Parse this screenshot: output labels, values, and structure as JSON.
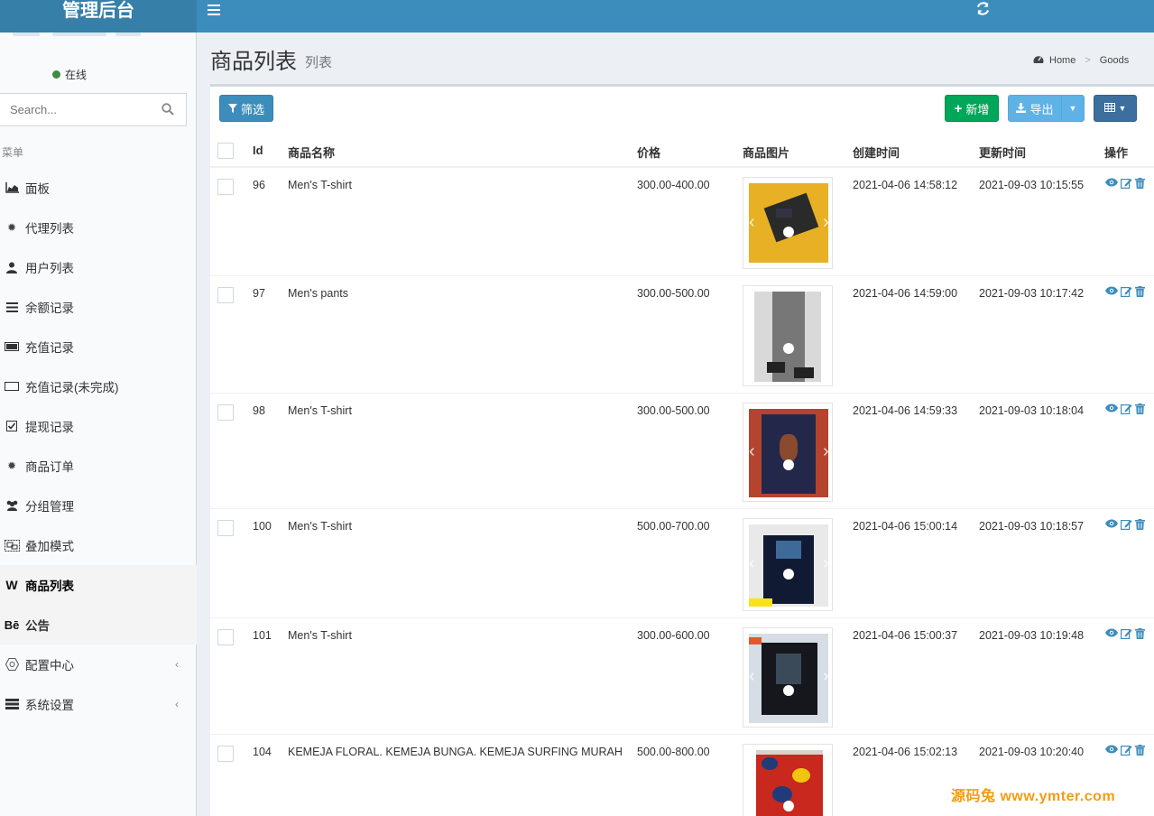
{
  "header": {
    "brand": "管理后台"
  },
  "sidebar": {
    "status_text": "在线",
    "search_placeholder": "Search...",
    "menu_header": "菜单",
    "items": [
      {
        "label": "面板",
        "icon": "area-chart-icon"
      },
      {
        "label": "代理列表",
        "icon": "gear-icon"
      },
      {
        "label": "用户列表",
        "icon": "user-icon"
      },
      {
        "label": "余额记录",
        "icon": "list-icon"
      },
      {
        "label": "充值记录",
        "icon": "battery-icon"
      },
      {
        "label": "充值记录(未完成)",
        "icon": "battery-empty-icon"
      },
      {
        "label": "提现记录",
        "icon": "check-square-icon"
      },
      {
        "label": "商品订单",
        "icon": "gear-icon"
      },
      {
        "label": "分组管理",
        "icon": "users-icon"
      },
      {
        "label": "叠加模式",
        "icon": "object-group-icon"
      },
      {
        "label": "商品列表",
        "icon": "wikipedia-icon"
      },
      {
        "label": "公告",
        "icon": "behance-icon"
      },
      {
        "label": "配置中心",
        "icon": "cog-icon"
      },
      {
        "label": "系统设置",
        "icon": "server-icon"
      }
    ]
  },
  "page": {
    "title": "商品列表",
    "subtitle": "列表",
    "breadcrumb": [
      "Home",
      "Goods"
    ]
  },
  "toolbar": {
    "filter_label": "筛选",
    "add_label": "新增",
    "export_label": "导出"
  },
  "table": {
    "columns": [
      "Id",
      "商品名称",
      "价格",
      "商品图片",
      "创建时间",
      "更新时间",
      "操作"
    ],
    "rows": [
      {
        "id": "96",
        "name": "Men's T-shirt",
        "price": "300.00-400.00",
        "created": "2021-04-06 14:58:12",
        "updated": "2021-09-03 10:15:55"
      },
      {
        "id": "97",
        "name": "Men's pants",
        "price": "300.00-500.00",
        "created": "2021-04-06 14:59:00",
        "updated": "2021-09-03 10:17:42"
      },
      {
        "id": "98",
        "name": "Men's T-shirt",
        "price": "300.00-500.00",
        "created": "2021-04-06 14:59:33",
        "updated": "2021-09-03 10:18:04"
      },
      {
        "id": "100",
        "name": "Men's T-shirt",
        "price": "500.00-700.00",
        "created": "2021-04-06 15:00:14",
        "updated": "2021-09-03 10:18:57"
      },
      {
        "id": "101",
        "name": "Men's T-shirt",
        "price": "300.00-600.00",
        "created": "2021-04-06 15:00:37",
        "updated": "2021-09-03 10:19:48"
      },
      {
        "id": "104",
        "name": "KEMEJA FLORAL. KEMEJA BUNGA. KEMEJA SURFING MURAH",
        "price": "500.00-800.00",
        "created": "2021-04-06 15:02:13",
        "updated": "2021-09-03 10:20:40"
      }
    ]
  },
  "watermark": "源码兔 www.ymter.com",
  "colors": {
    "header": "#3c8dbc",
    "brand": "#367fa9",
    "add": "#00a65a",
    "export": "#5fb2e5"
  }
}
